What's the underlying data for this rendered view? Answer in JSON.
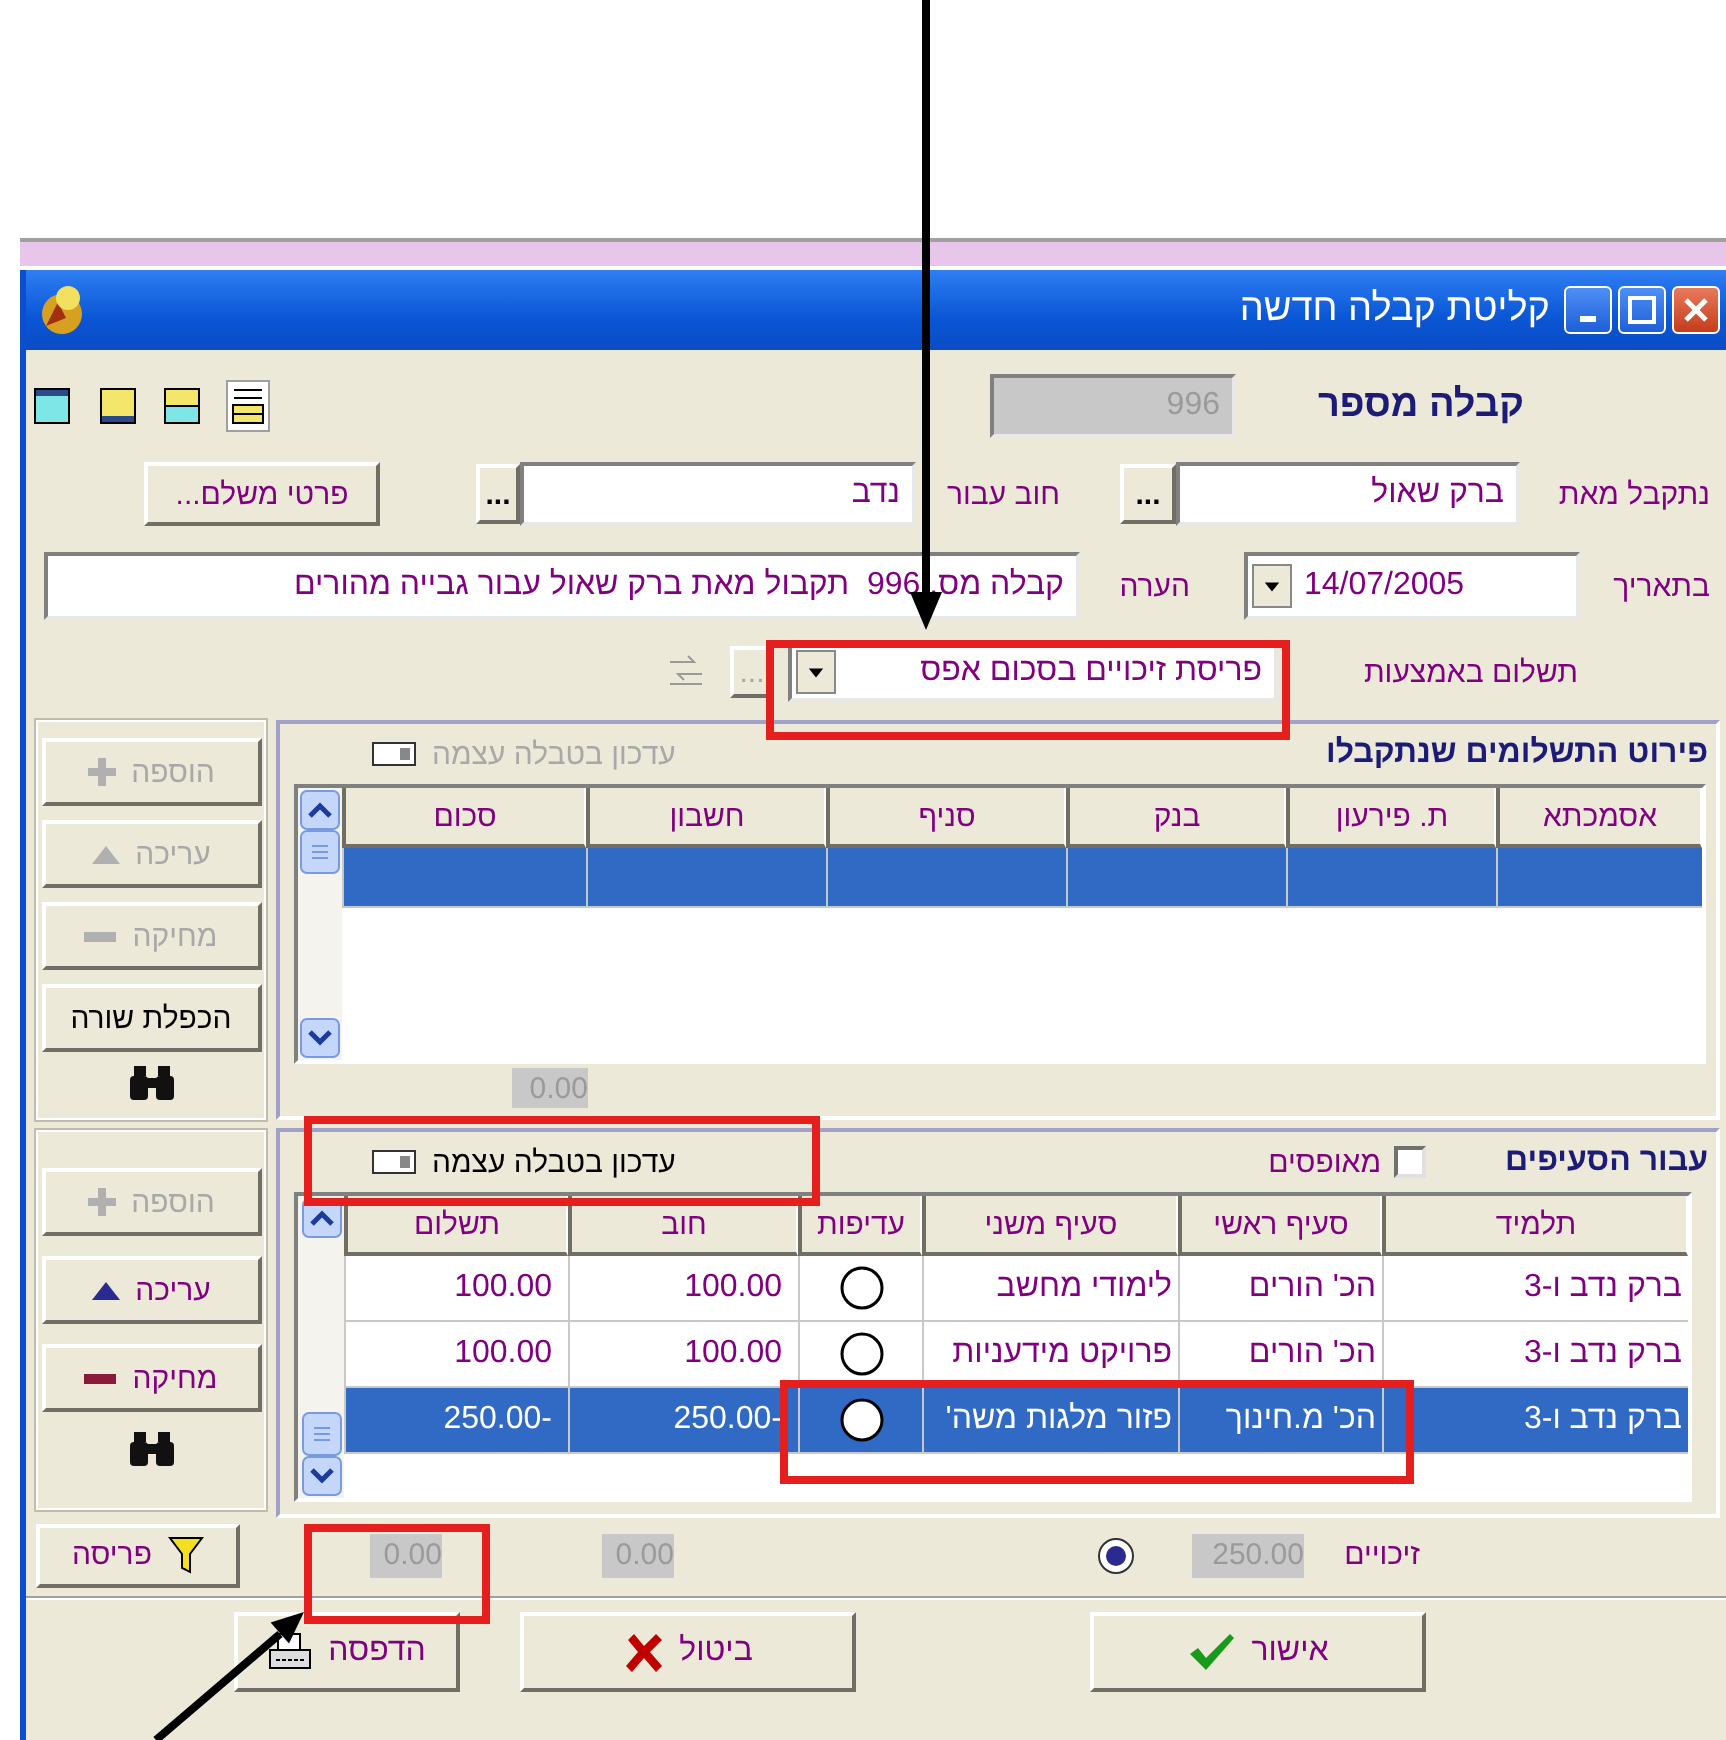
{
  "window": {
    "title": "קליטת קבלה חדשה"
  },
  "view_buttons": [
    {
      "kind": "top",
      "selected": false
    },
    {
      "kind": "bottom",
      "selected": false
    },
    {
      "kind": "split",
      "selected": false
    },
    {
      "kind": "list",
      "selected": true
    }
  ],
  "receipt": {
    "label": "קבלה מספר",
    "number": "996"
  },
  "received_from": {
    "label": "נתקבל מאת",
    "value": "ברק שאול",
    "browse": "..."
  },
  "debt_for": {
    "label": "חוב עבור",
    "value": "נדב",
    "browse": "..."
  },
  "payer_button": "פרטי משלם...",
  "remark": {
    "label": "הערה",
    "value": "קבלה מס. 996  תקבול מאת ברק שאול עבור גבייה מהורים"
  },
  "date": {
    "label": "בתאריך",
    "value": "14/07/2005"
  },
  "payment_method": {
    "label": "תשלום באמצעות",
    "value": "פריסת זיכויים בסכום אפס",
    "browse": "..."
  },
  "payments": {
    "title": "פירוט התשלומים שנתקבלו",
    "update_toggle": {
      "label": "עדכון בטבלה עצמה",
      "disabled": true
    },
    "columns": [
      "אסמכתא",
      "ת. פירעון",
      "בנק",
      "סניף",
      "חשבון",
      "סכום"
    ],
    "rows": [
      {
        "selected": true
      }
    ],
    "total": "0.00"
  },
  "payments_buttons": [
    {
      "kind": "add",
      "label": "הוספה",
      "disabled": true
    },
    {
      "kind": "edit",
      "label": "עריכה",
      "disabled": true
    },
    {
      "kind": "delete",
      "label": "מחיקה",
      "disabled": true
    },
    {
      "kind": "duplicate",
      "label": "הכפלת שורה",
      "disabled": false
    }
  ],
  "items": {
    "title": "עבור הסעיפים",
    "reset_checkbox": {
      "label": "מאופסים",
      "checked": false
    },
    "update_toggle": {
      "label": "עדכון בטבלה עצמה",
      "disabled": false
    },
    "columns": [
      "תלמיד",
      "סעיף ראשי",
      "סעיף משני",
      "עדיפות",
      "חוב",
      "תשלום"
    ],
    "rows": [
      {
        "student": "ברק נדב ו-3",
        "main": "הכ' הורים",
        "sub": "לימודי מחשב",
        "debt": "100.00",
        "payment": "100.00",
        "selected": false
      },
      {
        "student": "ברק נדב ו-3",
        "main": "הכ' הורים",
        "sub": "פרויקט מידעניות",
        "debt": "100.00",
        "payment": "100.00",
        "selected": false
      },
      {
        "student": "ברק נדב ו-3",
        "main": "הכ' מ.חינוך",
        "sub": "פזור מלגות משה'",
        "debt": "250.00-",
        "payment": "250.00-",
        "selected": true
      }
    ]
  },
  "items_buttons": [
    {
      "kind": "add",
      "label": "הוספה",
      "disabled": true
    },
    {
      "kind": "edit",
      "label": "עריכה",
      "disabled": false
    },
    {
      "kind": "delete",
      "label": "מחיקה",
      "disabled": false
    }
  ],
  "summary": {
    "split_button": "פריסה",
    "totals": [
      "0.00",
      "0.00"
    ],
    "credit_radio": {
      "selected": true
    },
    "credit_value": "250.00",
    "credit_label": "זיכויים"
  },
  "footer_buttons": [
    {
      "kind": "ok",
      "label": "אישור"
    },
    {
      "kind": "cancel",
      "label": "ביטול"
    },
    {
      "kind": "print",
      "label": "הדפסה"
    }
  ]
}
